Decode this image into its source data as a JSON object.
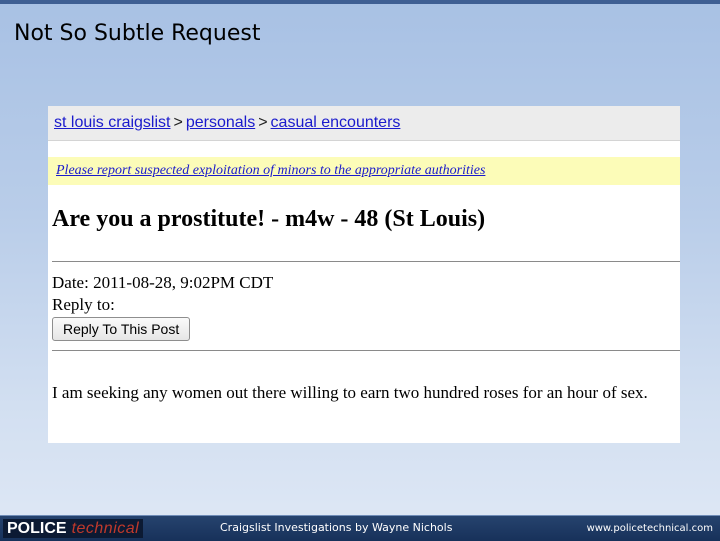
{
  "slide": {
    "title": "Not So Subtle Request"
  },
  "craigslist": {
    "breadcrumb": {
      "city": "st louis craigslist",
      "section": "personals",
      "subsection": "casual encounters",
      "separator": ">"
    },
    "notice": "Please report suspected exploitation of minors to the appropriate authorities",
    "post_title": "Are you a prostitute! - m4w - 48 (St Louis)",
    "date": "Date: 2011-08-28, 9:02PM CDT",
    "reply_to": "Reply to:",
    "reply_button": "Reply To This Post",
    "body": "I am seeking any women out there willing to earn two hundred roses for an hour of sex."
  },
  "footer": {
    "logo_primary": "POLICE",
    "logo_secondary": "technical",
    "center": "Craigslist Investigations  by Wayne Nichols",
    "right": "www.policetechnical.com"
  },
  "colors": {
    "link": "#1a1acc",
    "notice_bg": "#fcfcb8",
    "footer_bg": "#1f3a65",
    "logo_accent": "#c0392b"
  }
}
